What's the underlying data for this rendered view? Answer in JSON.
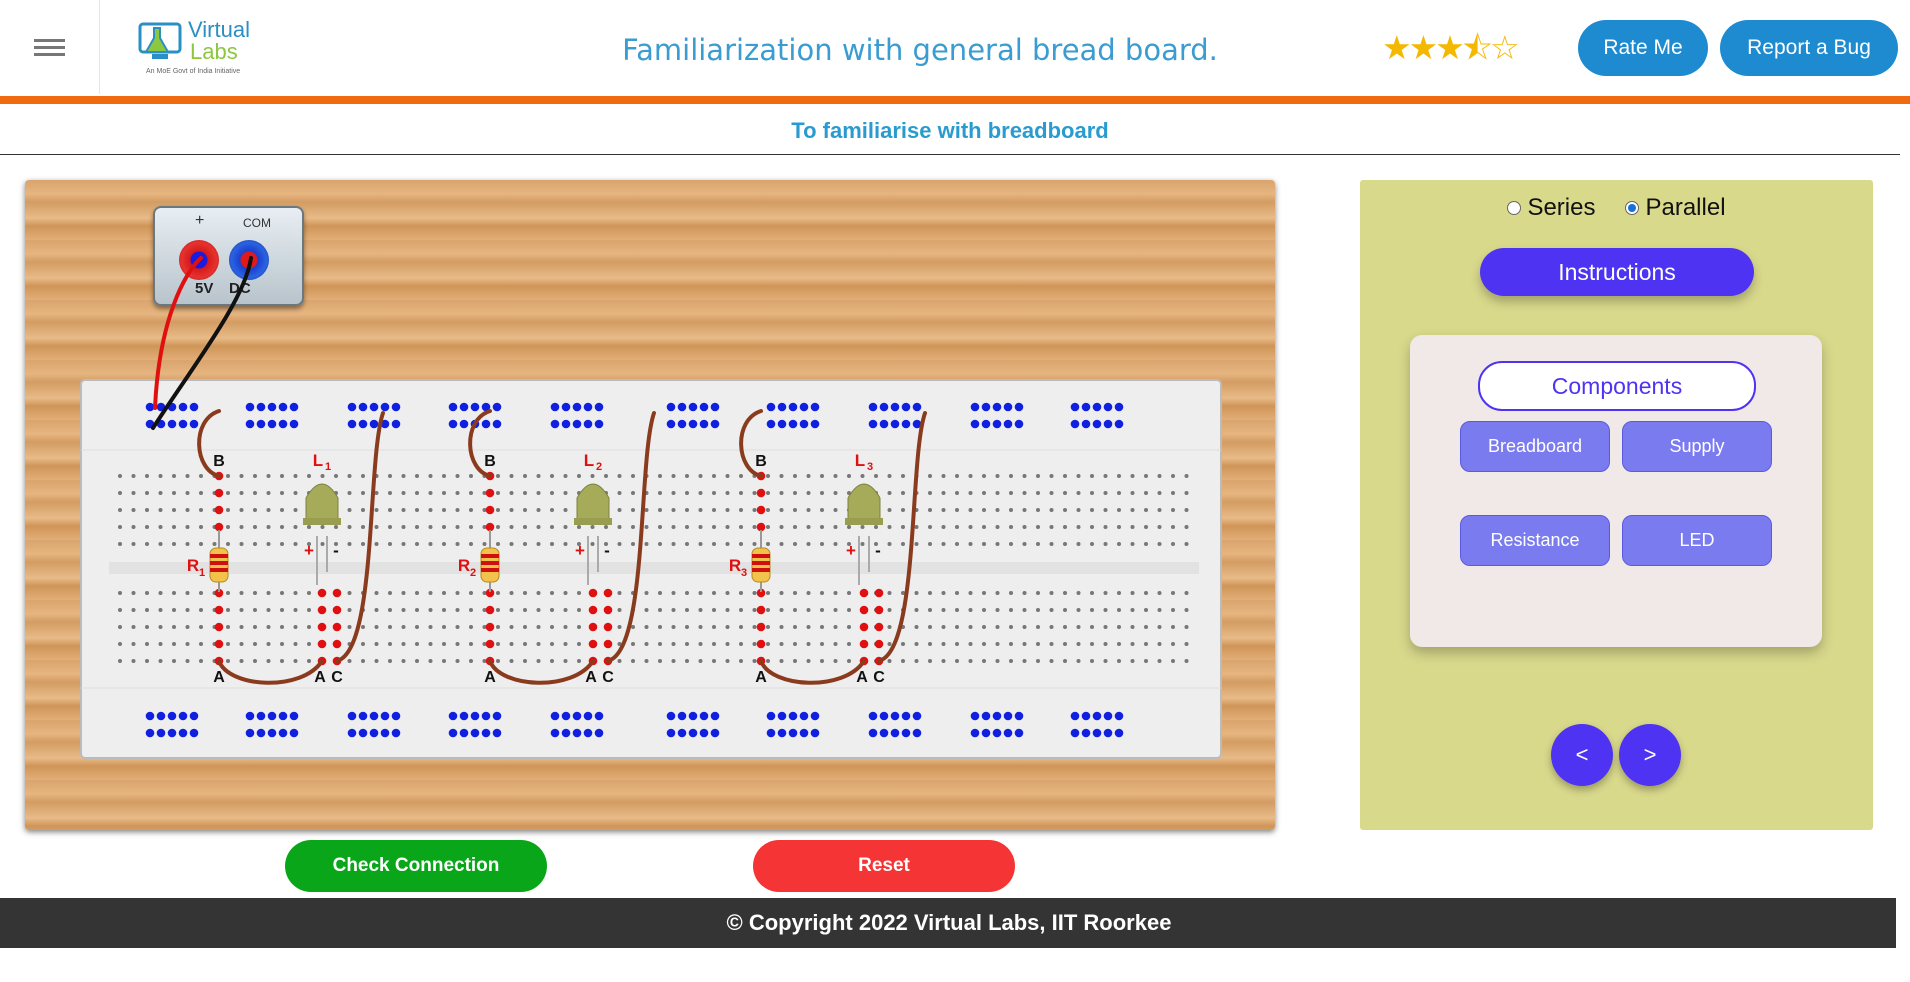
{
  "header": {
    "logo": {
      "line1": "Virtual",
      "line2": "Labs",
      "tagline": "An MoE Govt of India Initiative"
    },
    "title": "Familiarization with general bread board.",
    "rating": {
      "value": 3.5,
      "max": 5
    },
    "rate_button": "Rate Me",
    "bug_button": "Report a Bug"
  },
  "subtitle": "To familiarise with breadboard",
  "board": {
    "power_supply": {
      "plus_label": "+",
      "com_label": "COM",
      "left_label": "5V",
      "right_label": "DC"
    },
    "circuits": [
      {
        "r_label": "R",
        "r_sub": "1",
        "l_label": "L",
        "l_sub": "1",
        "b": "B",
        "a1": "A",
        "a2": "A",
        "c": "C"
      },
      {
        "r_label": "R",
        "r_sub": "2",
        "l_label": "L",
        "l_sub": "2",
        "b": "B",
        "a1": "A",
        "a2": "A",
        "c": "C"
      },
      {
        "r_label": "R",
        "r_sub": "3",
        "l_label": "L",
        "l_sub": "3",
        "b": "B",
        "a1": "A",
        "a2": "A",
        "c": "C"
      }
    ],
    "led_plus": "+",
    "led_minus": "-"
  },
  "panel": {
    "mode_options": [
      "Series",
      "Parallel"
    ],
    "mode_selected": "Parallel",
    "instructions_button": "Instructions",
    "components_title": "Components",
    "components": [
      "Breadboard",
      "Supply",
      "Resistance",
      "LED"
    ],
    "prev": "<",
    "next": ">"
  },
  "actions": {
    "check": "Check Connection",
    "reset": "Reset"
  },
  "colors": {
    "accent_blue": "#1e8bd0",
    "orange": "#f26a10",
    "violet": "#4e33f2",
    "green": "#0aa619",
    "red": "#f53535"
  },
  "footer": "© Copyright 2022 Virtual Labs, IIT Roorkee"
}
